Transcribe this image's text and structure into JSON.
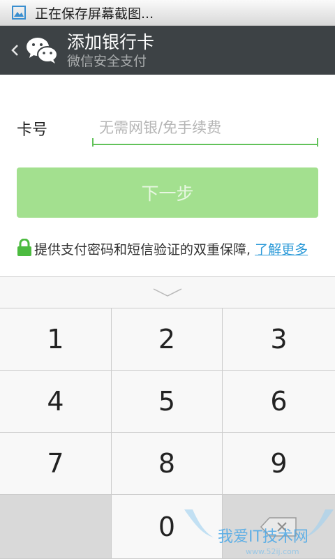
{
  "status_bar": {
    "text": "正在保存屏幕截图..."
  },
  "header": {
    "title": "添加银行卡",
    "subtitle": "微信安全支付"
  },
  "form": {
    "card_label": "卡号",
    "card_placeholder": "无需网银/免手续费"
  },
  "next_button": {
    "label": "下一步"
  },
  "notice": {
    "text": "提供支付密码和短信验证的双重保障,",
    "link": "了解更多"
  },
  "keypad": {
    "keys": [
      "1",
      "2",
      "3",
      "4",
      "5",
      "6",
      "7",
      "8",
      "9",
      "",
      "0",
      ""
    ]
  },
  "colors": {
    "header_bg": "#3d4245",
    "accent_green": "#62c25a",
    "button_disabled": "#a3e08f",
    "link": "#2c9ad8"
  },
  "watermark": {
    "text": "我爱IT技术网",
    "url": "www.52ij.com"
  }
}
